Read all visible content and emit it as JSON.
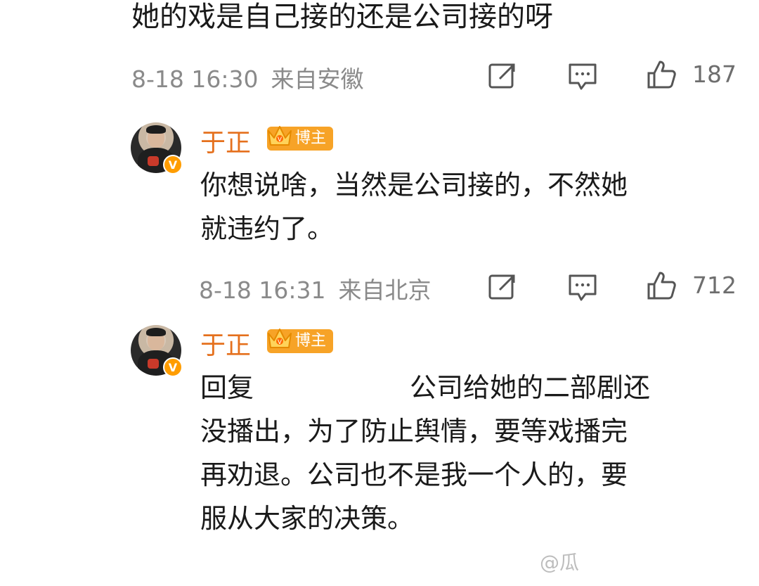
{
  "post": {
    "text": "她的戏是自己接的还是公司接的呀",
    "time": "8-18 16:30",
    "location": "来自安徽",
    "likes": "187"
  },
  "replies": [
    {
      "username": "于正",
      "badge": "博主",
      "text": "你想说啥，当然是公司接的，不然她就违约了。",
      "lines": [
        "你想说啥，当然是公司接的，不然她",
        "就违约了。"
      ],
      "time": "8-18 16:31",
      "location": "来自北京",
      "likes": "712"
    },
    {
      "username": "于正",
      "badge": "博主",
      "reply_prefix": "回复",
      "lines": [
        "公司给她的二部剧还",
        "没播出，为了防止舆情，要等戏播完",
        "再劝退。公司也不是我一个人的，要",
        "服从大家的决策。"
      ]
    }
  ],
  "icons": {
    "repost": "repost-icon",
    "comment": "comment-icon",
    "like": "thumbs-up-icon",
    "verified": "v-badge-icon",
    "crown": "crown-icon"
  },
  "colors": {
    "username": "#e5701d",
    "badge": "#f7a327",
    "meta": "#8a8a8a"
  },
  "watermark": "@瓜"
}
